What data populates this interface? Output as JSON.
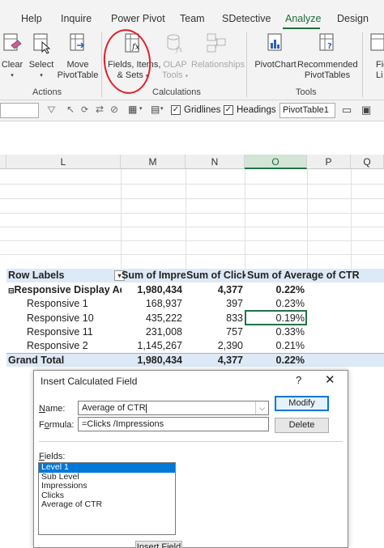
{
  "tabs": [
    "Help",
    "Inquire",
    "Power Pivot",
    "Team",
    "SDetective",
    "Analyze",
    "Design"
  ],
  "active_tab": "Analyze",
  "ribbon": {
    "actions": {
      "clear_label": "Clear",
      "select_label": "Select",
      "move_label_1": "Move",
      "move_label_2": "PivotTable",
      "group": "Actions"
    },
    "calculations": {
      "fields_label_1": "Fields, Items,",
      "fields_label_2": "& Sets",
      "olap_label_1": "OLAP",
      "olap_label_2": "Tools",
      "relationships_label": "Relationships",
      "group": "Calculations"
    },
    "tools": {
      "pivotchart_label": "PivotChart",
      "recommended_label_1": "Recommended",
      "recommended_label_2": "PivotTables",
      "group": "Tools"
    },
    "cut_off_1": "Fie",
    "cut_off_2": "Li"
  },
  "show_bar": {
    "gridlines_label": "Gridlines",
    "headings_label": "Headings",
    "pivot_name": "PivotTable1"
  },
  "grid": {
    "columns": [
      "L",
      "M",
      "N",
      "O",
      "P",
      "Q"
    ],
    "selected_column": "O"
  },
  "pivot": {
    "headers": [
      "Row Labels",
      "Sum of Impres",
      "Sum of Clicks",
      "Sum of Average of CTR"
    ],
    "group": {
      "label": "Responsive Display Ad",
      "impressions": "1,980,434",
      "clicks": "4,377",
      "ctr": "0.22%"
    },
    "rows": [
      {
        "label": "Responsive 1",
        "impressions": "168,937",
        "clicks": "397",
        "ctr": "0.23%"
      },
      {
        "label": "Responsive 10",
        "impressions": "435,222",
        "clicks": "833",
        "ctr": "0.19%"
      },
      {
        "label": "Responsive 11",
        "impressions": "231,008",
        "clicks": "757",
        "ctr": "0.33%"
      },
      {
        "label": "Responsive 2",
        "impressions": "1,145,267",
        "clicks": "2,390",
        "ctr": "0.21%"
      }
    ],
    "total": {
      "label": "Grand Total",
      "impressions": "1,980,434",
      "clicks": "4,377",
      "ctr": "0.22%"
    }
  },
  "dialog": {
    "title": "Insert Calculated Field",
    "help": "?",
    "close": "✕",
    "name_label": "Name:",
    "name_value": "Average of CTR",
    "formula_label": "Formula:",
    "formula_value": "=Clicks /Impressions",
    "modify_label": "Modify",
    "delete_label": "Delete",
    "fields_label": "Fields:",
    "fields": [
      "Level 1",
      "Sub Level",
      "Impressions",
      "Clicks",
      "Average of CTR"
    ],
    "selected_field": "Level 1",
    "insert_label": "Insert Field"
  },
  "colors": {
    "accent": "#1e6e3c",
    "pivot_header": "#dde9f6",
    "selection": "#0078d7",
    "annotation": "#e0202a"
  }
}
